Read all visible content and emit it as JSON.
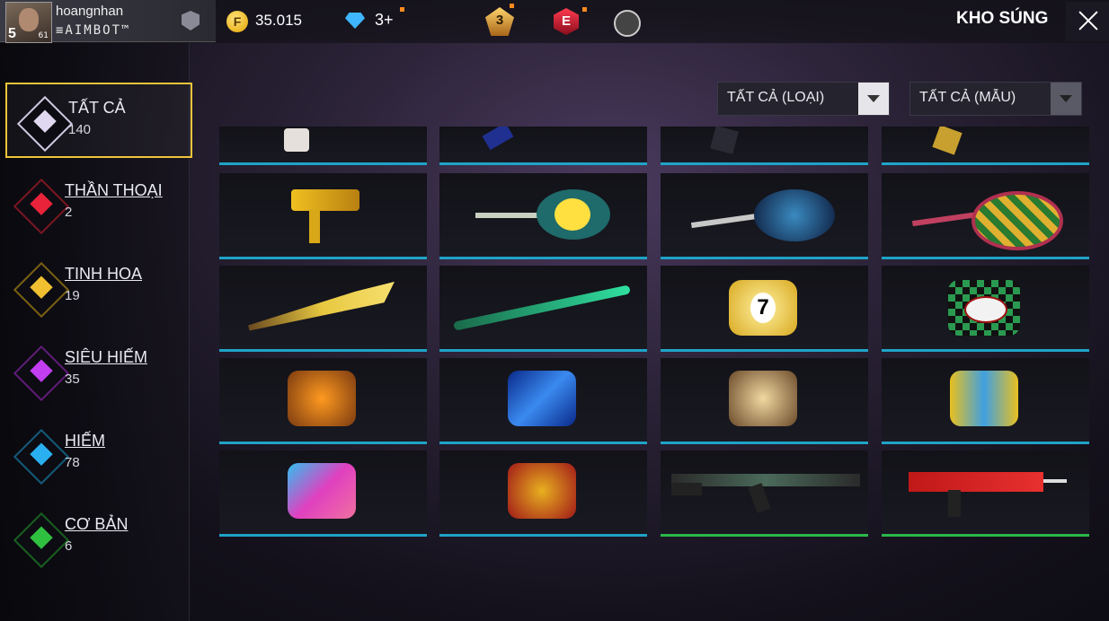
{
  "player": {
    "name": "hoangnhan",
    "clan": "≡AIMBOT™",
    "level": "5",
    "sublevel": "61"
  },
  "currency": {
    "gold": "35.015",
    "diamonds": "3+"
  },
  "header": {
    "title": "KHO SÚNG",
    "rank_badge_number": "3",
    "elite_letter": "E"
  },
  "filters": [
    {
      "label": "TẤT CẢ (LOẠI)"
    },
    {
      "label": "TẤT CẢ (MẪU)"
    }
  ],
  "categories": [
    {
      "name": "TẤT CẢ",
      "count": "140",
      "color": "#e0d8f0",
      "active": true
    },
    {
      "name": "THẦN THOẠI",
      "count": "2",
      "color": "#e8233a"
    },
    {
      "name": "TINH HOA",
      "count": "19",
      "color": "#f0c030"
    },
    {
      "name": "SIÊU HIẾM",
      "count": "35",
      "color": "#c23ef0"
    },
    {
      "name": "HIẾM",
      "count": "78",
      "color": "#2ab0f0"
    },
    {
      "name": "CƠ BẢN",
      "count": "6",
      "color": "#30c040"
    }
  ],
  "items": [
    {
      "icon": "grenade-item-icon",
      "rarity": "rare"
    },
    {
      "icon": "pistol-item-icon",
      "rarity": "rare"
    },
    {
      "icon": "pistol-item-icon",
      "rarity": "rare"
    },
    {
      "icon": "pistol-gold-item-icon",
      "rarity": "rare"
    },
    {
      "icon": "uzi-gold-icon",
      "rarity": "rare"
    },
    {
      "icon": "pan-egg-icon",
      "rarity": "rare"
    },
    {
      "icon": "pan-lightning-icon",
      "rarity": "rare"
    },
    {
      "icon": "pan-checker-icon",
      "rarity": "rare"
    },
    {
      "icon": "machete-gold-icon",
      "rarity": "rare"
    },
    {
      "icon": "bat-green-icon",
      "rarity": "rare"
    },
    {
      "icon": "fist-wrap-seven-icon",
      "rarity": "rare"
    },
    {
      "icon": "fist-wrap-demon-slayer-icon",
      "rarity": "rare"
    },
    {
      "icon": "fist-wrap-pumpkin-icon",
      "rarity": "rare"
    },
    {
      "icon": "fist-wrap-blue-icon",
      "rarity": "rare"
    },
    {
      "icon": "fist-wrap-gold-icon",
      "rarity": "rare"
    },
    {
      "icon": "fist-wrap-cross-icon",
      "rarity": "rare"
    },
    {
      "icon": "fist-wrap-holi-icon",
      "rarity": "rare"
    },
    {
      "icon": "fist-wrap-dragon-icon",
      "rarity": "rare"
    },
    {
      "icon": "ak47-icon",
      "rarity": "common"
    },
    {
      "icon": "famas-red-icon",
      "rarity": "common"
    }
  ]
}
